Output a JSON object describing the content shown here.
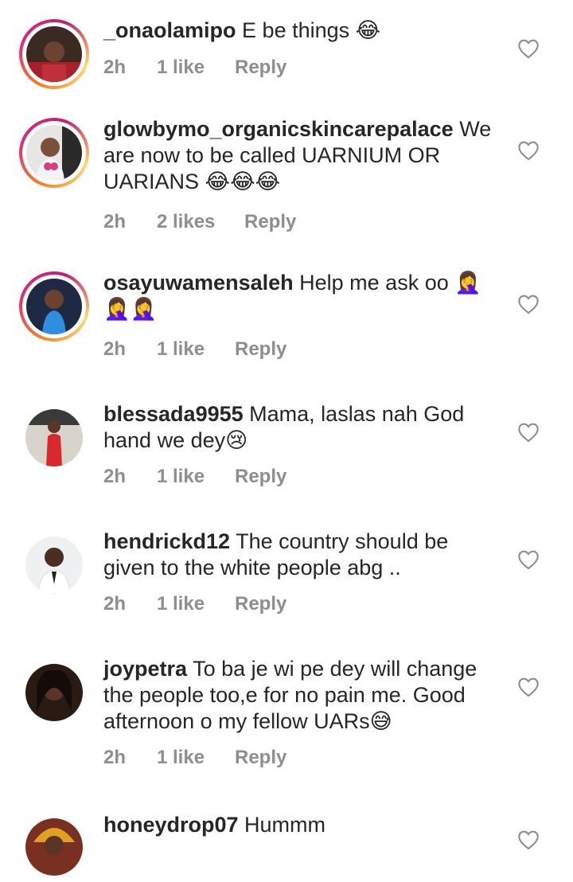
{
  "comments": [
    {
      "username": "_onaolamipo",
      "text": "E be things 😂",
      "time": "2h",
      "likes": "1 like",
      "reply": "Reply"
    },
    {
      "username": "glowbymo_organicskincarepalace",
      "text": "We are now to be called UARNIUM OR UARIANS 😂😂😂",
      "time": "2h",
      "likes": "2 likes",
      "reply": "Reply"
    },
    {
      "username": "osayuwamensaleh",
      "text": "Help me ask oo 🤦‍♀️🤦‍♀️🤦‍♀️",
      "time": "2h",
      "likes": "1 like",
      "reply": "Reply"
    },
    {
      "username": "blessada9955",
      "text": "Mama, laslas nah God hand we dey😢",
      "time": "2h",
      "likes": "1 like",
      "reply": "Reply"
    },
    {
      "username": "hendrickd12",
      "text": "The country should be given to the white people abg ..",
      "time": "2h",
      "likes": "1 like",
      "reply": "Reply"
    },
    {
      "username": "joypetra",
      "text": "To ba je wi pe dey will change the people too,e for no pain me. Good afternoon o my fellow UARs😅",
      "time": "2h",
      "likes": "1 like",
      "reply": "Reply"
    },
    {
      "username": "honeydrop07",
      "text": "Hummm"
    }
  ]
}
